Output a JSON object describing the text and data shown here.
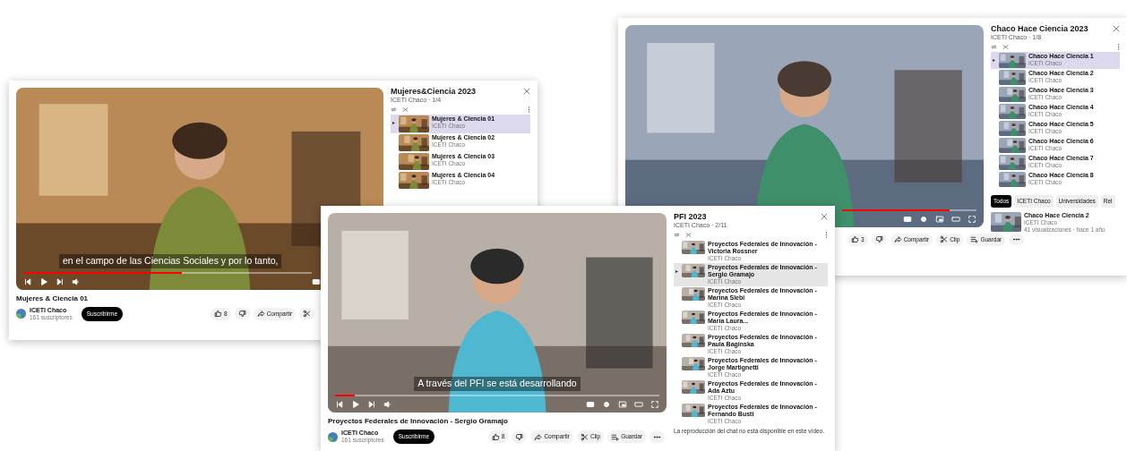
{
  "players": [
    {
      "progress": {
        "level": 0.55
      },
      "caption": "en el campo de las Ciencias Sociales y por lo tanto,",
      "title": "Mujeres & Ciencia 01",
      "channel": "ICETI Chaco",
      "subscribers": "161 suscriptores",
      "subscribe": "Suscribirme",
      "actions": [
        {
          "kind": "like",
          "label": "8"
        },
        {
          "kind": "dislike"
        },
        {
          "kind": "share",
          "label": "Compartir"
        },
        {
          "kind": "clip"
        }
      ],
      "playlist": {
        "title": "Mujeres&Ciencia 2023",
        "meta": "ICETI Chaco · 1/4",
        "items": [
          {
            "title": "Mujeres & Ciencia 01",
            "channel": "ICETI Chaco",
            "selected": true
          },
          {
            "title": "Mujeres & Ciencia 02",
            "channel": "ICETI Chaco",
            "selected": false
          },
          {
            "title": "Mujeres & Ciencia 03",
            "channel": "ICETI Chaco",
            "selected": false
          },
          {
            "title": "Mujeres & Ciencia 04",
            "channel": "ICETI Chaco",
            "selected": false
          }
        ]
      }
    },
    {
      "progress": {
        "level": 0.8
      },
      "actions": [
        {
          "kind": "like",
          "label": "3"
        },
        {
          "kind": "dislike"
        },
        {
          "kind": "share",
          "label": "Compartir"
        },
        {
          "kind": "clip",
          "label": "Clip"
        },
        {
          "kind": "save",
          "label": "Guardar"
        },
        {
          "kind": "more"
        }
      ],
      "playlist": {
        "title": "Chaco Hace Ciencia 2023",
        "meta": "ICETI Chaco · 1/8",
        "items": [
          {
            "title": "Chaco Hace Ciencia 1",
            "channel": "ICETI Chaco",
            "selected": true
          },
          {
            "title": "Chaco Hace Ciencia 2",
            "channel": "ICETI Chaco",
            "selected": false
          },
          {
            "title": "Chaco Hace Ciencia 3",
            "channel": "ICETI Chaco",
            "selected": false
          },
          {
            "title": "Chaco Hace Ciencia 4",
            "channel": "ICETI Chaco",
            "selected": false
          },
          {
            "title": "Chaco Hace Ciencia 5",
            "channel": "ICETI Chaco",
            "selected": false
          },
          {
            "title": "Chaco Hace Ciencia 6",
            "channel": "ICETI Chaco",
            "selected": false
          },
          {
            "title": "Chaco Hace Ciencia 7",
            "channel": "ICETI Chaco",
            "selected": false
          },
          {
            "title": "Chaco Hace Ciencia 8",
            "channel": "ICETI Chaco",
            "selected": false
          }
        ],
        "chips": [
          {
            "label": "Todos",
            "selected": true
          },
          {
            "label": "ICETI Chaco",
            "selected": false
          },
          {
            "label": "Universidades",
            "selected": false
          },
          {
            "label": "Rel",
            "selected": false
          }
        ],
        "recommended": {
          "title": "Chaco Hace Ciencia 2",
          "channel": "ICETI Chaco",
          "meta": "41 visualizaciones · hace 1 año"
        }
      }
    },
    {
      "progress": {
        "level": 0.06
      },
      "caption": "A través del PFI se está desarrollando",
      "title": "Proyectos Federales de Innovación - Sergio Gramajo",
      "channel": "ICETI Chaco",
      "subscribers": "161 suscriptores",
      "subscribe": "Suscribirme",
      "actions": [
        {
          "kind": "like",
          "label": "8"
        },
        {
          "kind": "dislike"
        },
        {
          "kind": "share",
          "label": "Compartir"
        },
        {
          "kind": "clip",
          "label": "Clip"
        },
        {
          "kind": "save",
          "label": "Guardar"
        },
        {
          "kind": "more"
        }
      ],
      "playlist": {
        "title": "PFI 2023",
        "meta": "ICETI Chaco · 2/11",
        "items": [
          {
            "title": "Proyectos Federales de Innovación - Victoria Rossner",
            "channel": "ICETI Chaco",
            "selected": false
          },
          {
            "title": "Proyectos Federales de Innovación - Sergio Gramajo",
            "channel": "ICETI Chaco",
            "selected": true
          },
          {
            "title": "Proyectos Federales de Innovación - Marina Slebi",
            "channel": "ICETI Chaco",
            "selected": false
          },
          {
            "title": "Proyectos Federales de Innovación - María Laura...",
            "channel": "ICETI Chaco",
            "selected": false
          },
          {
            "title": "Proyectos Federales de Innovación - Paula Baginska",
            "channel": "ICETI Chaco",
            "selected": false
          },
          {
            "title": "Proyectos Federales de Innovación - Jorge Martignetti",
            "channel": "ICETI Chaco",
            "selected": false
          },
          {
            "title": "Proyectos Federales de Innovación - Ada Aztu",
            "channel": "ICETI Chaco",
            "selected": false
          },
          {
            "title": "Proyectos Federales de Innovación - Fernando Busti",
            "channel": "ICETI Chaco",
            "selected": false
          }
        ],
        "footer": "La reproducción del chat no está disponible en este vídeo."
      }
    }
  ]
}
